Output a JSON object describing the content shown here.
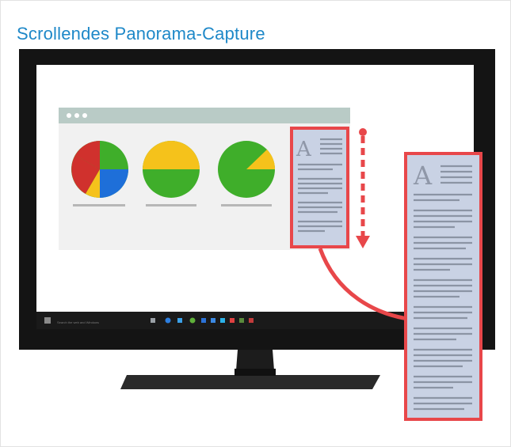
{
  "title": "Scrollendes Panorama-Capture",
  "taskbar": {
    "search_text": "Search the web and Windows"
  },
  "colors": {
    "title": "#1e88c8",
    "highlight": "#e8474a",
    "doc_fill": "#c9d2e4",
    "pie_green": "#3fae2a",
    "pie_yellow": "#f5c21b",
    "pie_red": "#d0312d",
    "pie_blue": "#1e6fd9"
  },
  "icons": [
    "window-dots-icon",
    "document-icon",
    "scroll-arrow-icon",
    "curved-arrow-icon",
    "start-icon"
  ]
}
